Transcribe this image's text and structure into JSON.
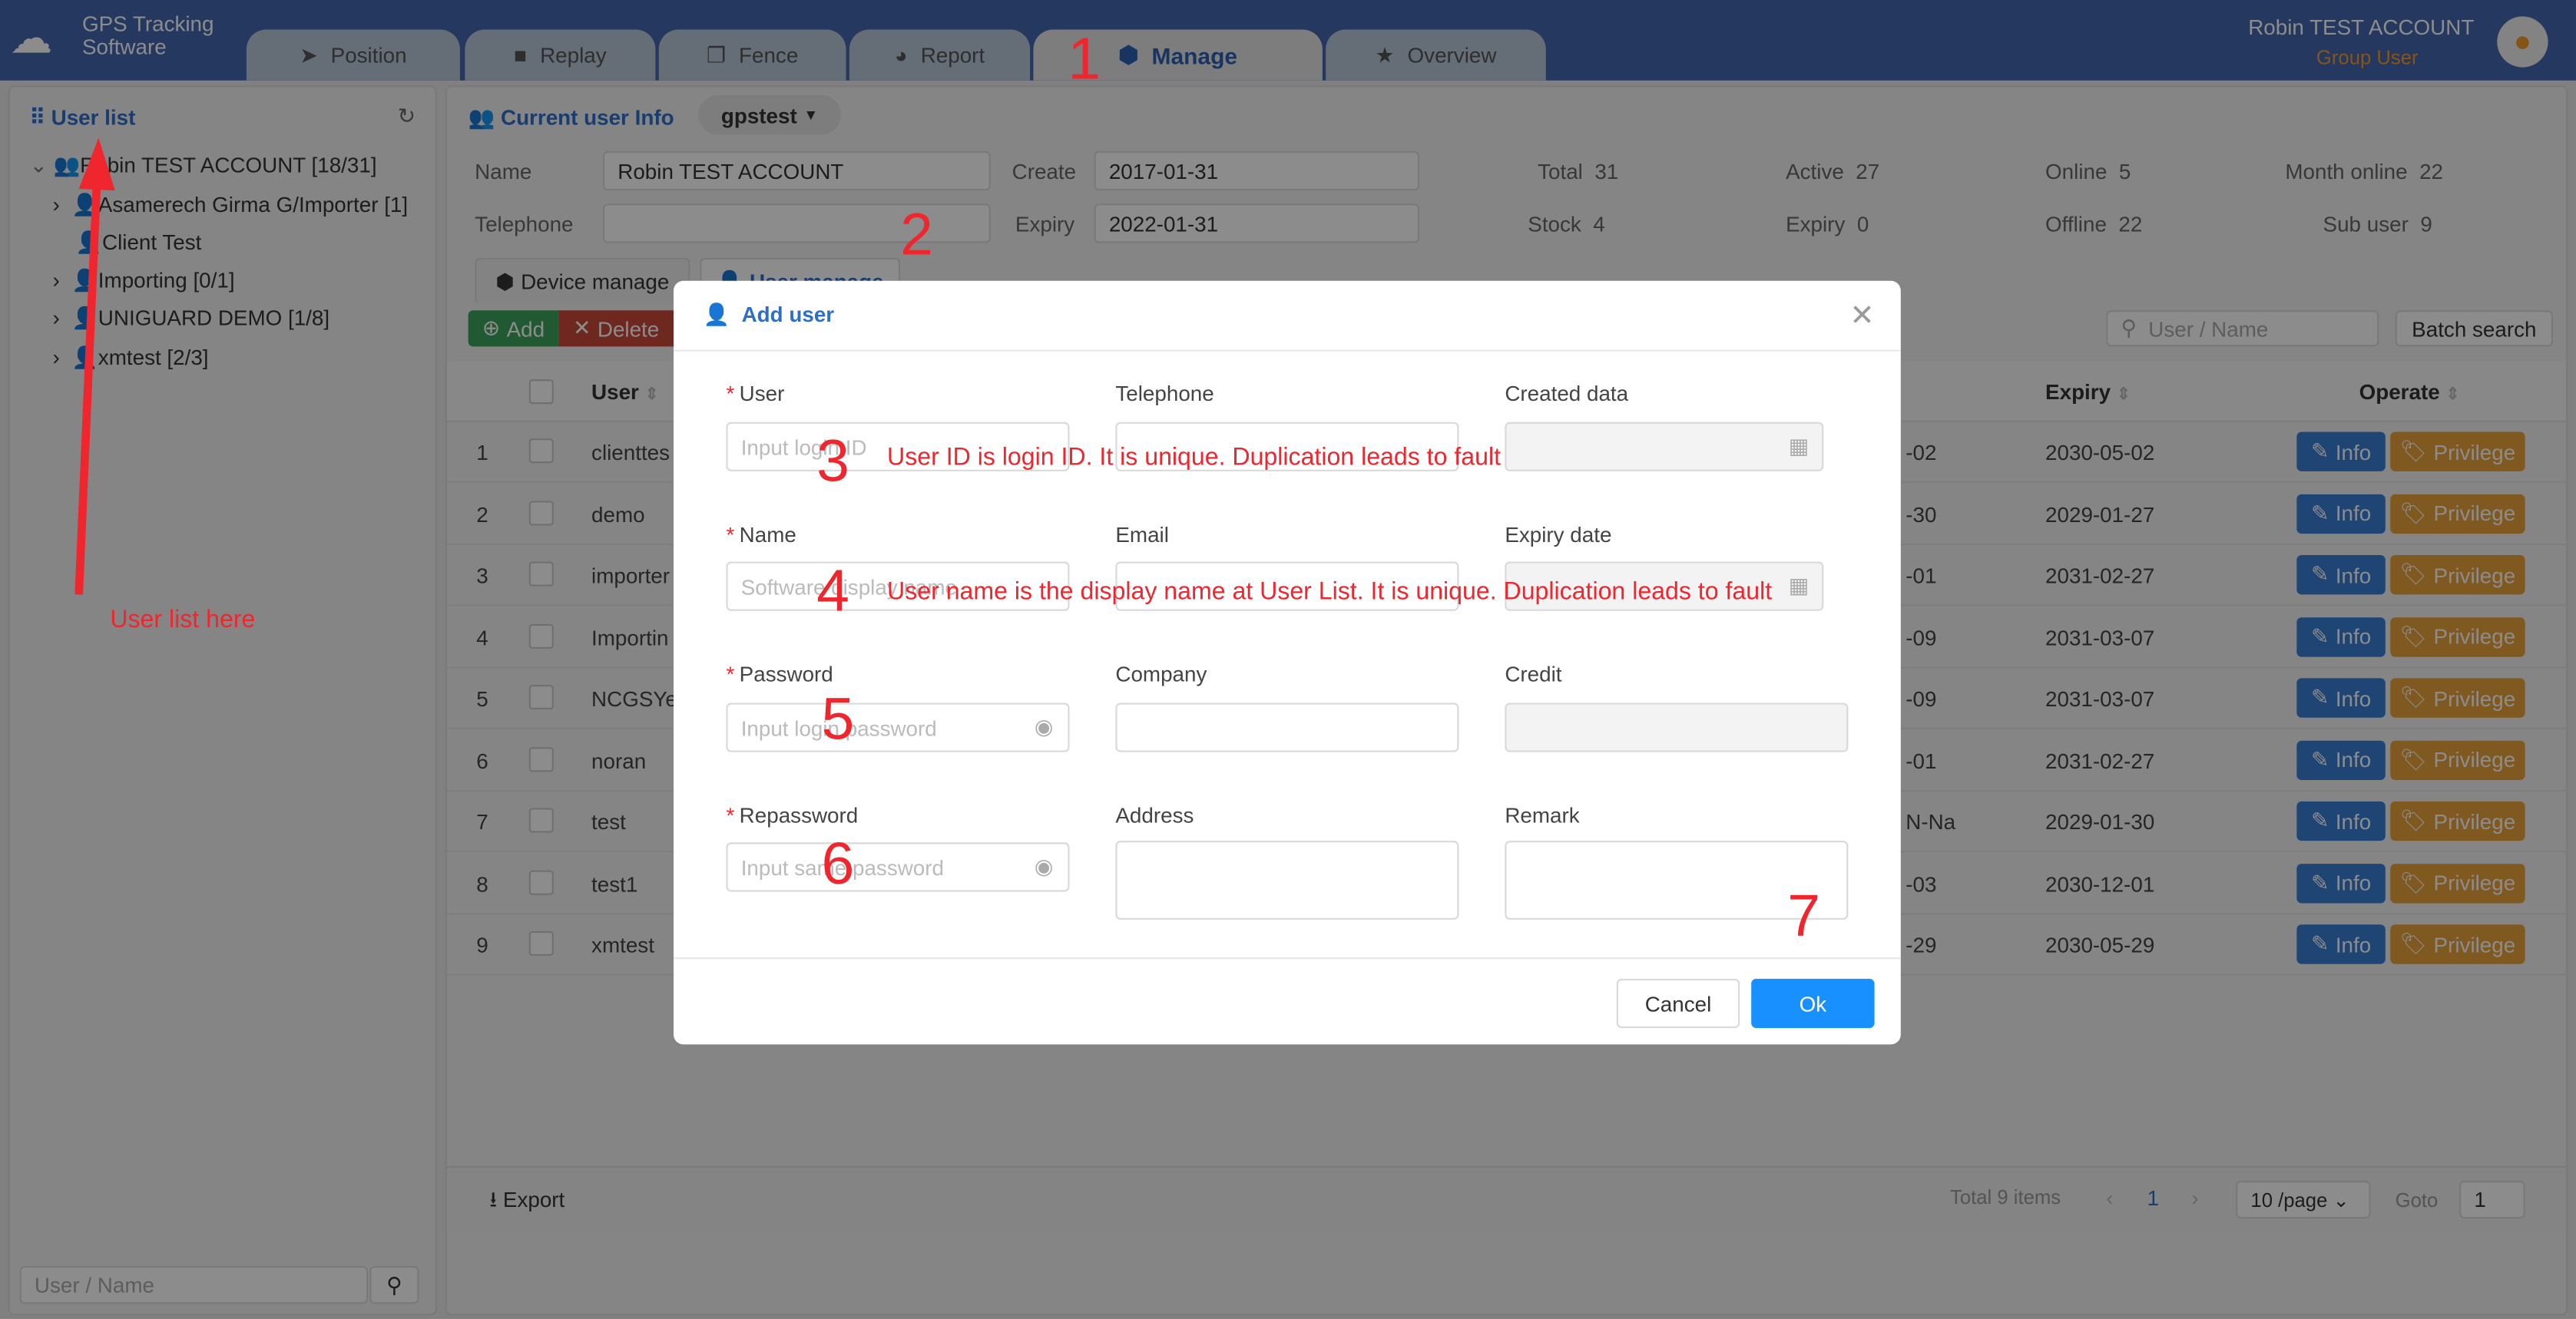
{
  "header": {
    "logo_line1": "GPS Tracking",
    "logo_line2": "Software",
    "user_name": "Robin TEST ACCOUNT",
    "user_role": "Group User",
    "tabs": [
      {
        "label": "Position",
        "icon": "send-icon"
      },
      {
        "label": "Replay",
        "icon": "video-icon"
      },
      {
        "label": "Fence",
        "icon": "copy-icon"
      },
      {
        "label": "Report",
        "icon": "pie-chart-icon"
      },
      {
        "label": "Manage",
        "icon": "cube-icon",
        "active": true
      },
      {
        "label": "Overview",
        "icon": "star-icon"
      }
    ]
  },
  "sidebar": {
    "title": "User list",
    "search_placeholder": "User / Name",
    "tree": [
      {
        "label": "Robin TEST ACCOUNT  [18/31]"
      },
      {
        "label": "Asamerech Girma G/Importer  [1]"
      },
      {
        "label": "Client Test"
      },
      {
        "label": "Importing  [0/1]"
      },
      {
        "label": "UNIGUARD DEMO  [1/8]"
      },
      {
        "label": "xmtest  [2/3]"
      }
    ]
  },
  "info": {
    "title": "Current user Info",
    "account": "gpstest",
    "name_label": "Name",
    "name_value": "Robin TEST ACCOUNT",
    "telephone_label": "Telephone",
    "telephone_value": "",
    "create_label": "Create",
    "create_value": "2017-01-31",
    "expiry_label": "Expiry",
    "expiry_value": "2022-01-31",
    "stats": [
      {
        "label": "Total",
        "value": "31"
      },
      {
        "label": "Active",
        "value": "27"
      },
      {
        "label": "Online",
        "value": "5"
      },
      {
        "label": "Month online",
        "value": "22"
      },
      {
        "label": "Stock",
        "value": "4"
      },
      {
        "label": "Expiry",
        "value": "0"
      },
      {
        "label": "Offline",
        "value": "22"
      },
      {
        "label": "Sub user",
        "value": "9"
      }
    ],
    "tab_device": "Device manage",
    "tab_user": "User manage"
  },
  "toolbar": {
    "add": "Add",
    "delete": "Delete",
    "search_placeholder": "User / Name",
    "batch_search": "Batch search"
  },
  "table": {
    "headers": {
      "user": "User",
      "expiry": "Expiry",
      "operate": "Operate"
    },
    "info_btn": "Info",
    "privilege_btn": "Privilege",
    "rows": [
      {
        "no": "1",
        "user": "clienttes",
        "col": "-02",
        "expiry": "2030-05-02"
      },
      {
        "no": "2",
        "user": "demo",
        "col": "-30",
        "expiry": "2029-01-27"
      },
      {
        "no": "3",
        "user": "importer",
        "col": "-01",
        "expiry": "2031-02-27"
      },
      {
        "no": "4",
        "user": "Importin",
        "col": "-09",
        "expiry": "2031-03-07"
      },
      {
        "no": "5",
        "user": "NCGSYe",
        "col": "-09",
        "expiry": "2031-03-07"
      },
      {
        "no": "6",
        "user": "noran",
        "col": "-01",
        "expiry": "2031-02-27"
      },
      {
        "no": "7",
        "user": "test",
        "col": "N-Na",
        "expiry": "2029-01-30"
      },
      {
        "no": "8",
        "user": "test1",
        "col": "-03",
        "expiry": "2030-12-01"
      },
      {
        "no": "9",
        "user": "xmtest",
        "col": "-29",
        "expiry": "2030-05-29"
      }
    ]
  },
  "footer": {
    "export": "Export",
    "total": "Total 9 items",
    "page": "1",
    "page_size": "10 /page",
    "goto_label": "Goto",
    "goto_value": "1"
  },
  "modal": {
    "title": "Add user",
    "user_label": "User",
    "user_placeholder": "Input login ID",
    "telephone_label": "Telephone",
    "created_label": "Created data",
    "name_label": "Name",
    "name_placeholder": "Software display name",
    "email_label": "Email",
    "expiry_label": "Expiry date",
    "password_label": "Password",
    "password_placeholder": "Input login password",
    "company_label": "Company",
    "credit_label": "Credit",
    "repassword_label": "Repassword",
    "repassword_placeholder": "Input same password",
    "address_label": "Address",
    "remark_label": "Remark",
    "cancel": "Cancel",
    "ok": "Ok"
  },
  "annotations": {
    "n1": "1",
    "n2": "2",
    "n3": "3",
    "n4": "4",
    "n5": "5",
    "n6": "6",
    "n7": "7",
    "note3": "User ID is login ID. It is unique. Duplication leads to fault",
    "note4": "User name is the display name at User List. It is unique. Duplication leads to fault",
    "user_list_note": "User list here"
  },
  "colors": {
    "header": "#4466b0",
    "primary": "#1890ff",
    "info": "#3a7fd5",
    "privilege": "#e8a23a",
    "add": "#3ca55c",
    "delete": "#c9493a",
    "annotation": "#f0262e"
  }
}
